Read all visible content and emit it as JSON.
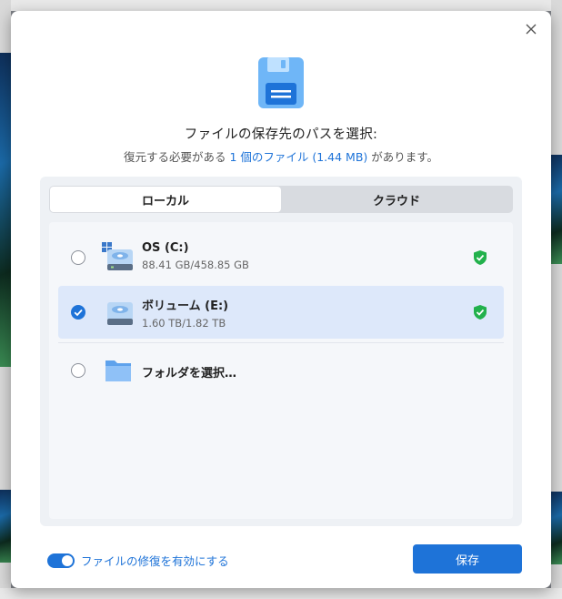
{
  "dialog": {
    "title": "ファイルの保存先のパスを選択:",
    "subtitle_prefix": "復元する必要がある",
    "subtitle_highlight": "1 個のファイル (1.44 MB)",
    "subtitle_suffix": "があります。"
  },
  "tabs": {
    "local": "ローカル",
    "cloud": "クラウド",
    "active": "local"
  },
  "drives": [
    {
      "name": "OS (C:)",
      "size": "88.41 GB/458.85 GB",
      "selected": false,
      "verified": true
    },
    {
      "name": "ボリューム (E:)",
      "size": "1.60 TB/1.82 TB",
      "selected": true,
      "verified": true
    }
  ],
  "folder_option": {
    "label": "フォルダを選択…",
    "selected": false
  },
  "footer": {
    "repair_toggle_label": "ファイルの修復を有効にする",
    "repair_enabled": true,
    "save_label": "保存"
  },
  "colors": {
    "accent": "#1e73d8",
    "selected_row": "#dde8fa",
    "shield": "#22b14c"
  }
}
